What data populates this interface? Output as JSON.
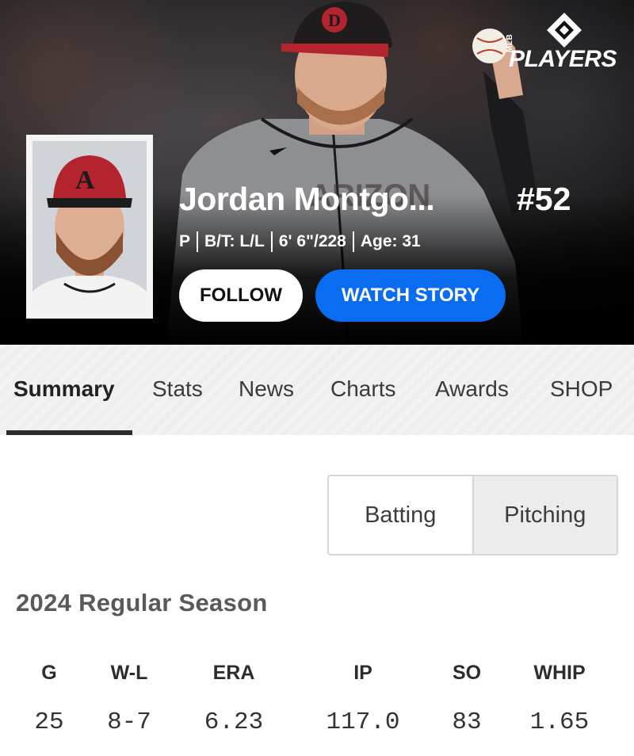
{
  "player": {
    "name": "Jordan Montgo...",
    "number": "#52",
    "meta": {
      "position": "P",
      "bats_throws": "B/T: L/L",
      "height_weight": "6' 6\"/228",
      "age": "Age: 31"
    }
  },
  "brand": {
    "logo_text": "PLAYERS",
    "logo_prefix": "MLB"
  },
  "actions": {
    "follow_label": "FOLLOW",
    "watch_label": "WATCH STORY"
  },
  "tabs": [
    {
      "label": "Summary",
      "active": true
    },
    {
      "label": "Stats"
    },
    {
      "label": "News"
    },
    {
      "label": "Charts"
    },
    {
      "label": "Awards"
    },
    {
      "label": "SHOP"
    }
  ],
  "toggle": {
    "batting_label": "Batting",
    "pitching_label": "Pitching",
    "selected": "Pitching"
  },
  "season": {
    "title": "2024 Regular Season",
    "stats": [
      {
        "label": "G",
        "value": "25"
      },
      {
        "label": "W-L",
        "value": "8-7"
      },
      {
        "label": "ERA",
        "value": "6.23"
      },
      {
        "label": "IP",
        "value": "117.0"
      },
      {
        "label": "SO",
        "value": "83"
      },
      {
        "label": "WHIP",
        "value": "1.65"
      }
    ]
  },
  "colors": {
    "primary_button": "#0a6cf0",
    "team_red": "#b3242e",
    "hero_bg": "#141314"
  },
  "icons": {
    "logo": "mlb-players-diamond-icon"
  }
}
